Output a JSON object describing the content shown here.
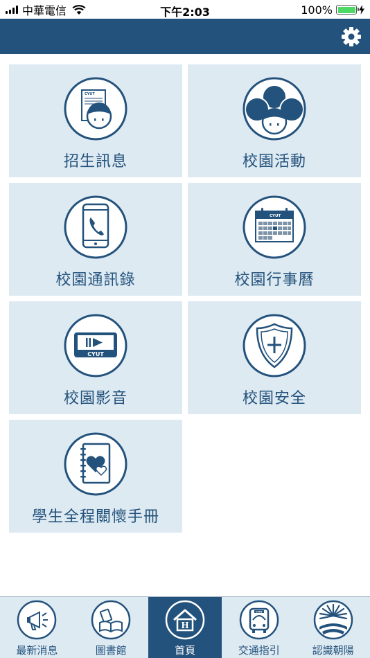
{
  "status_bar": {
    "carrier": "中華電信",
    "time": "下午2:03",
    "battery": "100%"
  },
  "colors": {
    "header": "#23527c",
    "tile_bg": "#deeaf2",
    "accent": "#23527c",
    "battery_fill": "#4cd964"
  },
  "header": {
    "settings_icon": "gear-icon"
  },
  "menu": {
    "items": [
      {
        "label": "招生訊息",
        "icon": "admission-icon"
      },
      {
        "label": "校園活動",
        "icon": "campus-activities-icon"
      },
      {
        "label": "校園通訊錄",
        "icon": "phone-directory-icon"
      },
      {
        "label": "校園行事曆",
        "icon": "calendar-icon"
      },
      {
        "label": "校園影音",
        "icon": "video-icon"
      },
      {
        "label": "校園安全",
        "icon": "shield-icon"
      },
      {
        "label": "學生全程關懷手冊",
        "icon": "care-handbook-icon"
      }
    ],
    "logo_text": "CYUT"
  },
  "tab_bar": {
    "tabs": [
      {
        "label": "最新消息",
        "icon": "megaphone-icon"
      },
      {
        "label": "圖書館",
        "icon": "books-icon"
      },
      {
        "label": "首頁",
        "icon": "home-icon",
        "active": true
      },
      {
        "label": "交通指引",
        "icon": "bus-icon"
      },
      {
        "label": "認識朝陽",
        "icon": "sun-emblem-icon"
      }
    ]
  }
}
